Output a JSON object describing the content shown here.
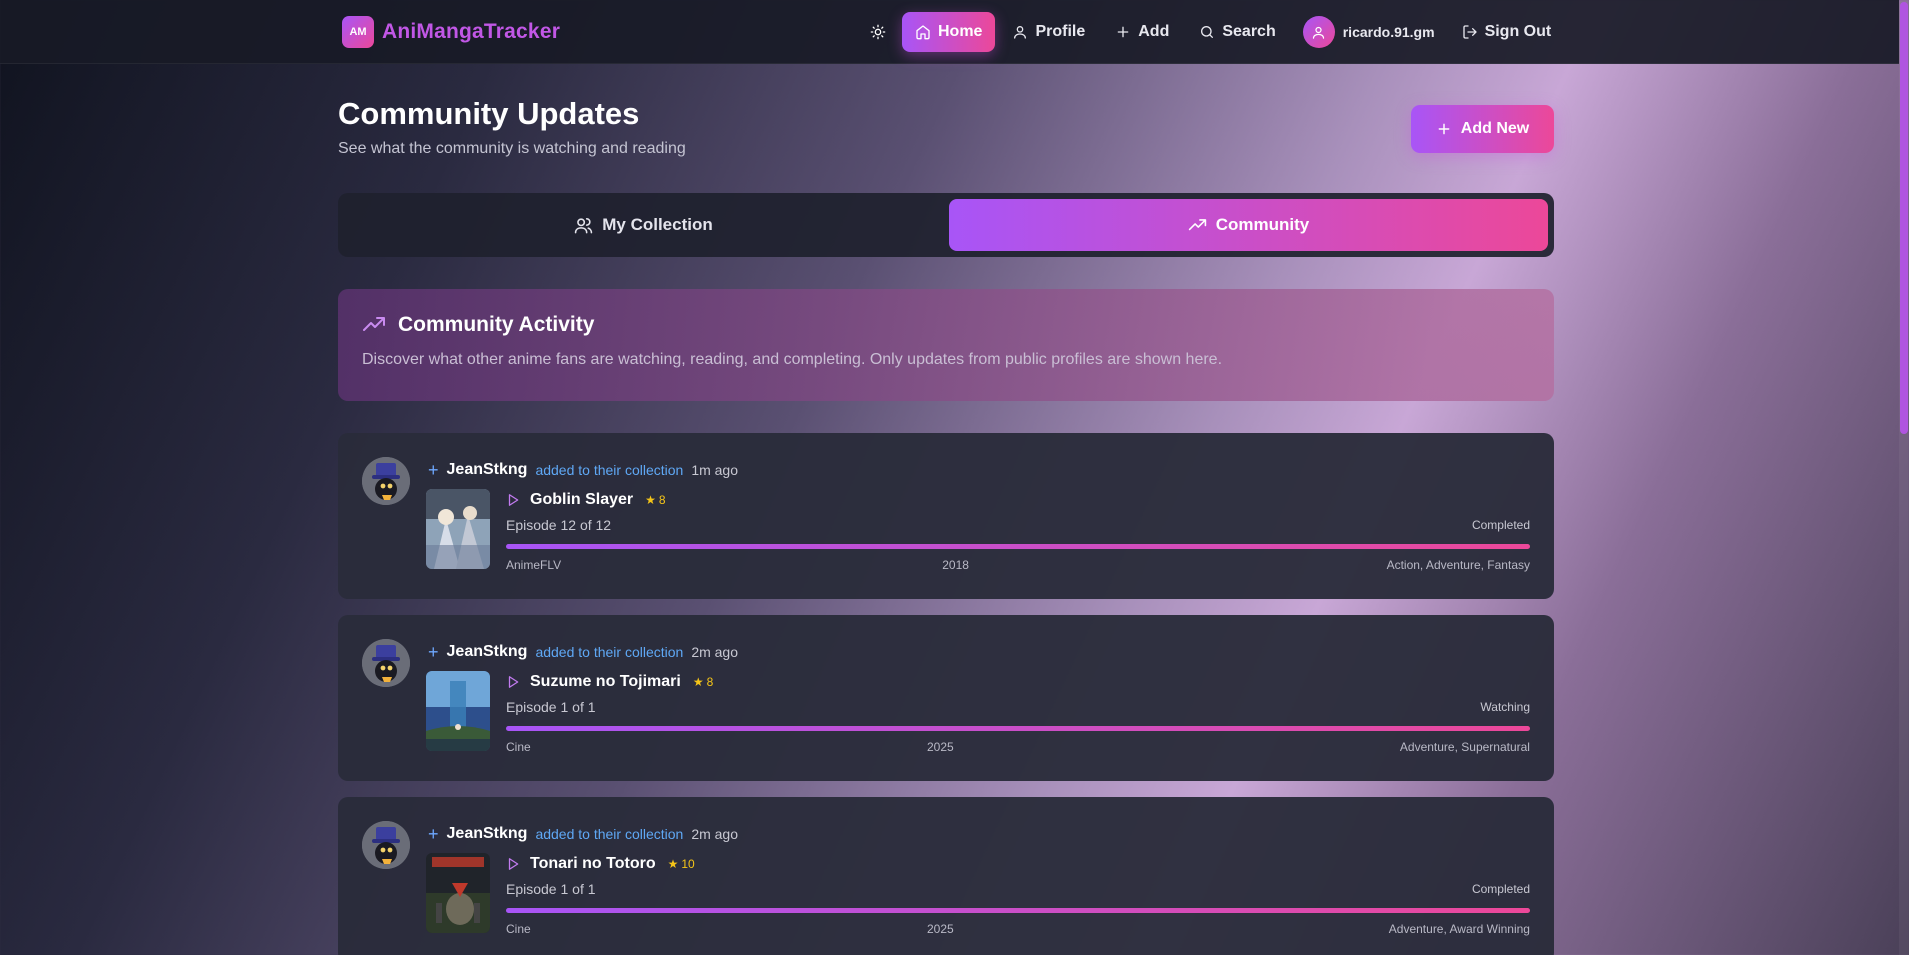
{
  "nav": {
    "logo_text": "AM",
    "brand": "AniMangaTracker",
    "home": "Home",
    "profile": "Profile",
    "add": "Add",
    "search": "Search",
    "username": "ricardo.91.gm",
    "signout": "Sign Out"
  },
  "header": {
    "title": "Community Updates",
    "subtitle": "See what the community is watching and reading",
    "add_new": "Add New"
  },
  "tabs": {
    "my_collection": "My Collection",
    "community": "Community"
  },
  "activity": {
    "title": "Community Activity",
    "description": "Discover what other anime fans are watching, reading, and completing. Only updates from public profiles are shown here."
  },
  "colors": {
    "accent_start": "#a855f7",
    "accent_end": "#ec4899",
    "link": "#5fa8f5",
    "star": "#f5c518"
  },
  "updates": [
    {
      "user": "JeanStkng",
      "action": "added to their collection",
      "time": "1m ago",
      "title": "Goblin Slayer",
      "rating": "8",
      "episode": "Episode 12 of 12",
      "status": "Completed",
      "progress": 1.0,
      "source": "AnimeFLV",
      "year": "2018",
      "genres": "Action, Adventure, Fantasy"
    },
    {
      "user": "JeanStkng",
      "action": "added to their collection",
      "time": "2m ago",
      "title": "Suzume no Tojimari",
      "rating": "8",
      "episode": "Episode 1 of 1",
      "status": "Watching",
      "progress": 1.0,
      "source": "Cine",
      "year": "2025",
      "genres": "Adventure, Supernatural"
    },
    {
      "user": "JeanStkng",
      "action": "added to their collection",
      "time": "2m ago",
      "title": "Tonari no Totoro",
      "rating": "10",
      "episode": "Episode 1 of 1",
      "status": "Completed",
      "progress": 1.0,
      "source": "Cine",
      "year": "2025",
      "genres": "Adventure, Award Winning"
    }
  ]
}
